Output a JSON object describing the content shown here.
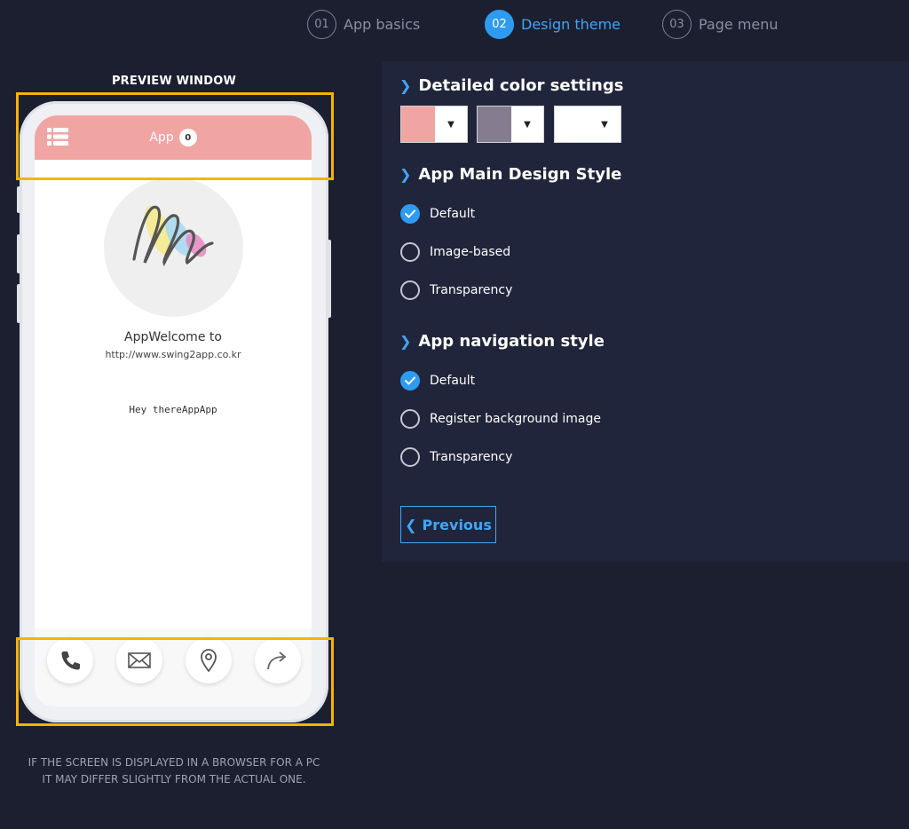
{
  "steps": [
    {
      "num": "01",
      "label": "App basics"
    },
    {
      "num": "02",
      "label": "Design theme"
    },
    {
      "num": "03",
      "label": "Page menu"
    }
  ],
  "preview": {
    "title": "PREVIEW WINDOW",
    "app_name": "App",
    "badge_count": "0",
    "welcome": "AppWelcome to",
    "url": "http://www.swing2app.co.kr",
    "greeting": "Hey thereAppApp",
    "bottom_icons": [
      "phone-icon",
      "mail-icon",
      "location-icon",
      "share-icon"
    ],
    "disclaimer_line1": "IF THE SCREEN IS DISPLAYED IN A BROWSER FOR A PC",
    "disclaimer_line2": "IT MAY DIFFER SLIGHTLY FROM THE ACTUAL ONE."
  },
  "settings": {
    "color_title": "Detailed color settings",
    "colors": [
      "#f1a5a3",
      "#857c8f",
      "#ffffff"
    ],
    "main_style": {
      "title": "App Main Design Style",
      "options": [
        "Default",
        "Image-based",
        "Transparency"
      ],
      "selected": "Default"
    },
    "nav_style": {
      "title": "App navigation style",
      "options": [
        "Default",
        "Register background image",
        "Transparency"
      ],
      "selected": "Default"
    },
    "previous_label": "Previous"
  },
  "theme": {
    "accent": "#2e9bf0",
    "background": "#1b1f30",
    "panel": "#21253b",
    "highlight": "#f5b400"
  }
}
